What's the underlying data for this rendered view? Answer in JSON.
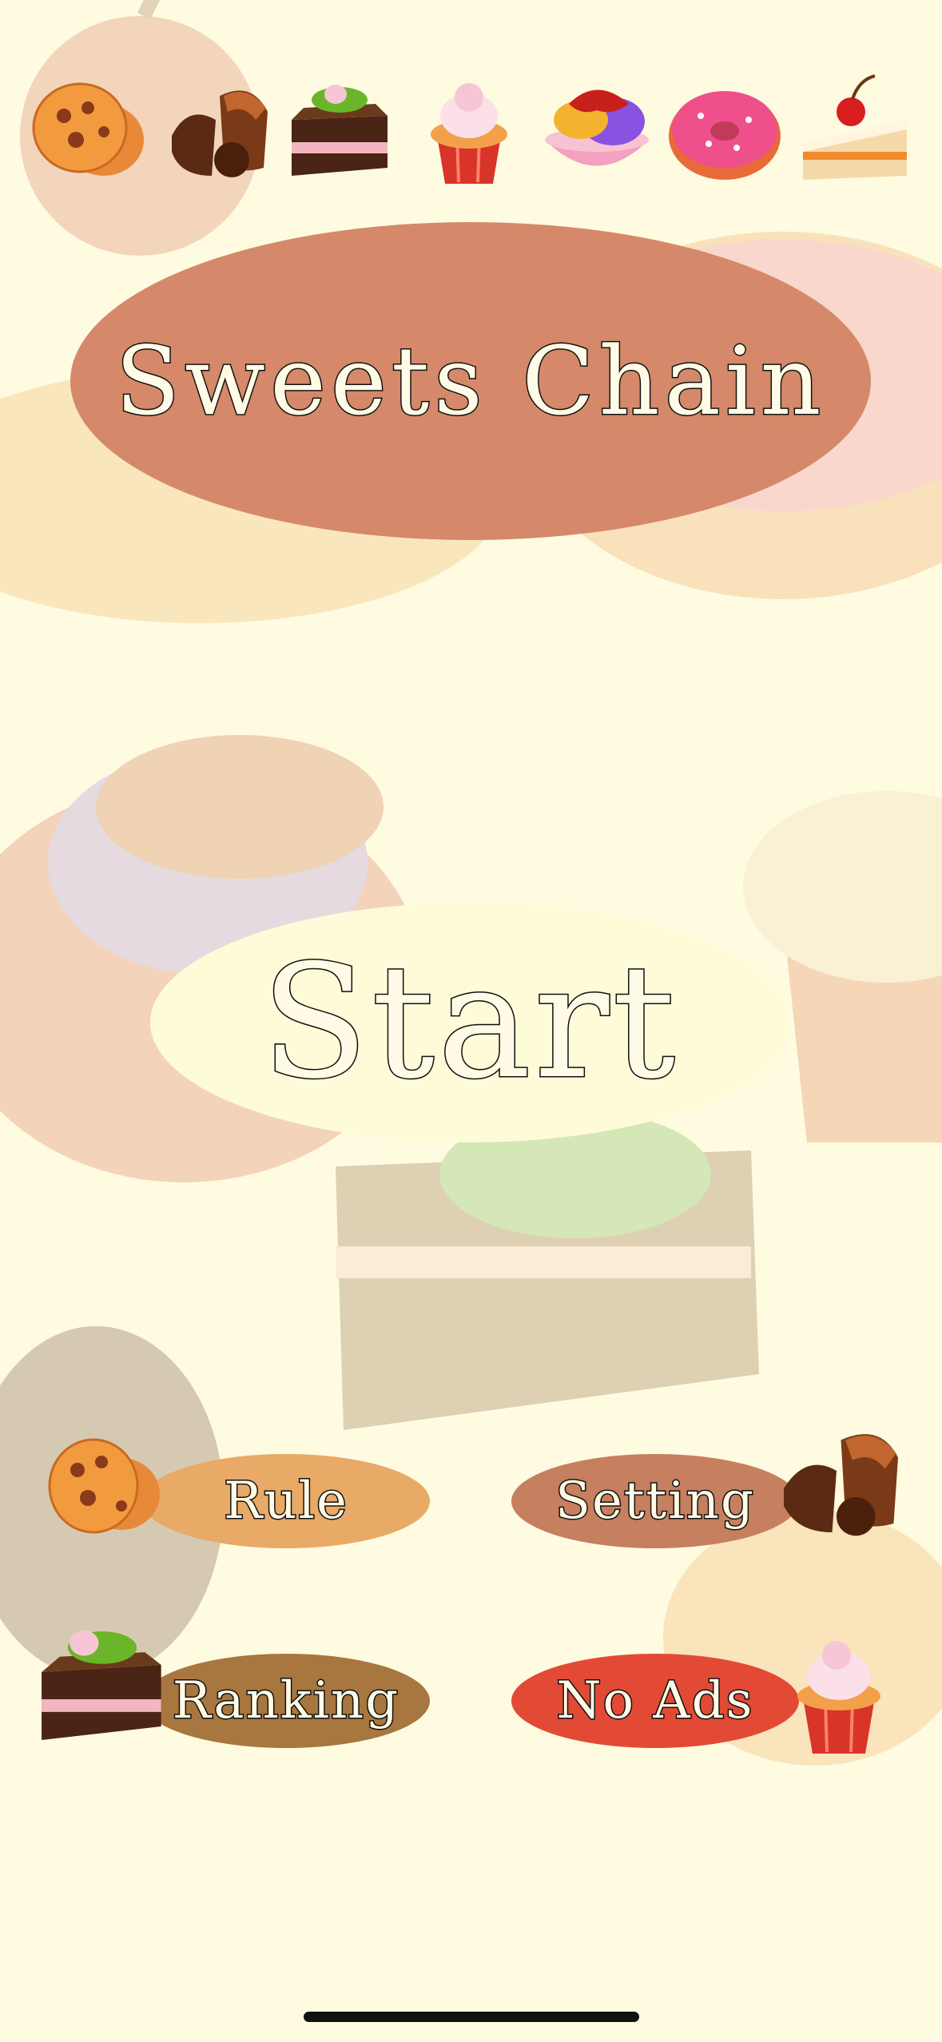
{
  "app": {
    "title": "Sweets Chain"
  },
  "start_label": "Start",
  "menu": {
    "rule_label": "Rule",
    "setting_label": "Setting",
    "ranking_label": "Ranking",
    "no_ads_label": "No Ads"
  },
  "top_sweets": [
    "cookie-icon",
    "chocolate-icon",
    "cake-slice-icon",
    "cupcake-icon",
    "ice-cream-bowl-icon",
    "donut-icon",
    "cherry-cake-icon"
  ],
  "colors": {
    "background": "#fefbe0",
    "title_oval": "#d5896a",
    "start_oval": "#fdfbd8",
    "rule_oval": "#e9a967",
    "setting_oval": "#c67f5f",
    "ranking_oval": "#a8763f",
    "no_ads_oval": "#e24a36"
  }
}
